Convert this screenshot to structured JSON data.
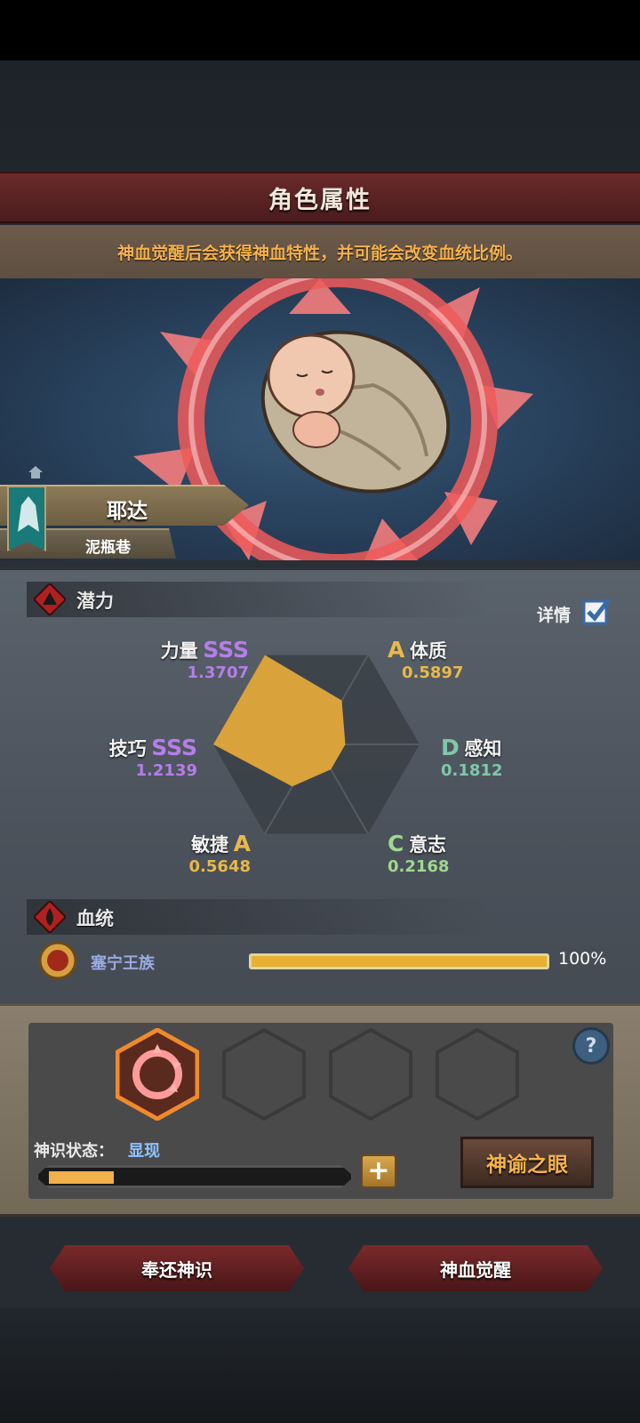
{
  "title": "角色属性",
  "hint": "神血觉醒后会获得神血特性，并可能会改变血统比例。",
  "character": {
    "name": "耶达",
    "location": "泥瓶巷"
  },
  "potential": {
    "section_label": "潜力",
    "detail_label": "详情",
    "detail_checked": true,
    "stats": [
      {
        "name": "力量",
        "grade": "SSS",
        "value": "1.3707",
        "color": "#b57ee8"
      },
      {
        "name": "体质",
        "grade": "A",
        "value": "0.5897",
        "color": "#e8b84a"
      },
      {
        "name": "感知",
        "grade": "D",
        "value": "0.1812",
        "color": "#7fc8a8"
      },
      {
        "name": "意志",
        "grade": "C",
        "value": "0.2168",
        "color": "#9fd88f"
      },
      {
        "name": "敏捷",
        "grade": "A",
        "value": "0.5648",
        "color": "#e8b84a"
      },
      {
        "name": "技巧",
        "grade": "SSS",
        "value": "1.2139",
        "color": "#b57ee8"
      }
    ]
  },
  "lineage": {
    "section_label": "血统",
    "name": "塞宁王族",
    "percent_text": "100%",
    "fraction": 1.0
  },
  "divine": {
    "state_label": "神识状态：",
    "state_value": "显现",
    "progress_fraction": 0.22,
    "plus_label": "+",
    "oracle_label": "神谕之眼",
    "help_label": "?"
  },
  "buttons": {
    "return": "奉还神识",
    "awaken": "神血觉醒"
  },
  "colors": {
    "accent": "#f6b24a",
    "title_bg": "#5a2224",
    "radar_fill": "#e3a83a"
  }
}
